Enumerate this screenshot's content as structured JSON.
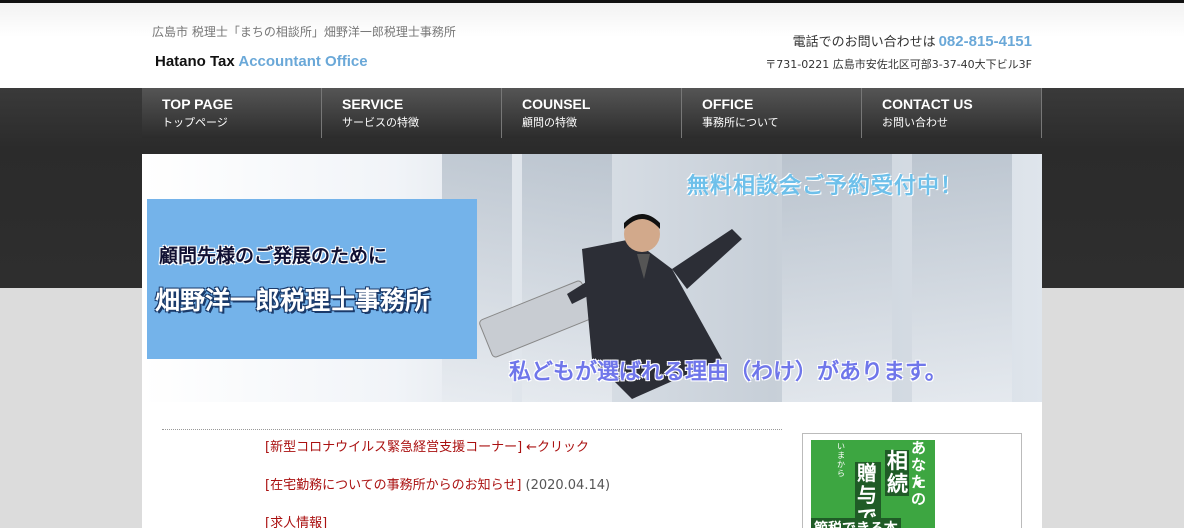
{
  "header": {
    "tagline": "広島市 税理士「まちの相談所」畑野洋一郎税理士事務所",
    "logo_main": "Hatano Tax",
    "logo_accent": "Accountant Office",
    "phone_label": "電話でのお問い合わせは",
    "phone_number": "082-815-4151",
    "address": "〒731-0221 広島市安佐北区可部3-37-40大下ビル3F"
  },
  "nav": [
    {
      "en": "TOP PAGE",
      "ja": "トップページ"
    },
    {
      "en": "SERVICE",
      "ja": "サービスの特徴"
    },
    {
      "en": "COUNSEL",
      "ja": "顧問の特徴"
    },
    {
      "en": "OFFICE",
      "ja": "事務所について"
    },
    {
      "en": "CONTACT US",
      "ja": "お問い合わせ"
    }
  ],
  "hero": {
    "top_text": "無料相談会ご予約受付中！",
    "panel_line1": "顧問先様のご発展のために",
    "panel_line2": "畑野洋一郎税理士事務所",
    "bottom_text": "私どもが選ばれる理由（わけ）があります。"
  },
  "news": [
    {
      "link": "[新型コロナウイルス緊急経営支援コーナー]",
      "tail": "←クリック",
      "date": ""
    },
    {
      "link": "[在宅勤務についての事務所からのお知らせ]",
      "tail": "",
      "date": "(2020.04.14)"
    },
    {
      "link": "[求人情報]",
      "tail": "",
      "date": ""
    }
  ],
  "sidebar_book": {
    "v1": "あなたの",
    "v2": "相続・",
    "v3": "贈与で",
    "small": "いまから",
    "bottom": "節税できる本"
  },
  "colors": {
    "accent_blue": "#6aa8d8",
    "link_red": "#aa1111",
    "panel_blue": "#74b3ea"
  }
}
